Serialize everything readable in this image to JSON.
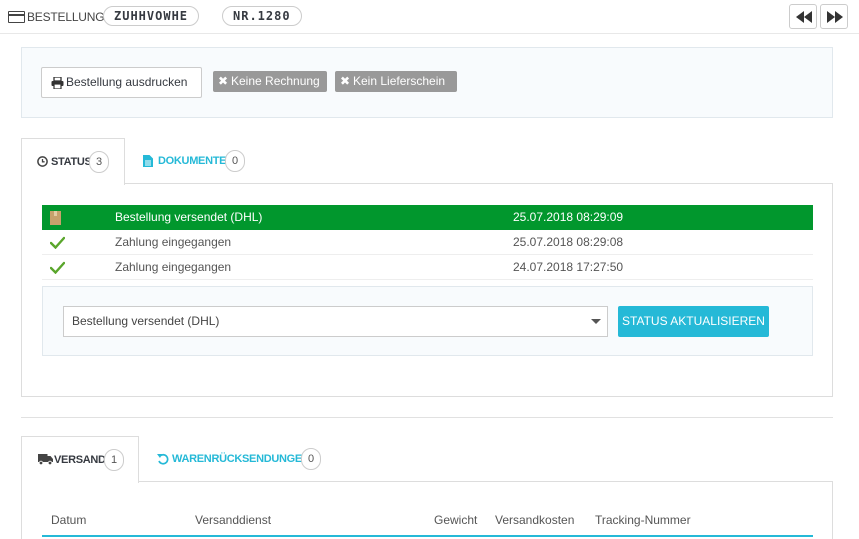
{
  "header": {
    "title": "BESTELLUNG",
    "reference": "ZUHHVOWHE",
    "number": "NR.1280",
    "icon": "credit-card-icon",
    "prev_icon": "backward-icon",
    "next_icon": "forward-icon"
  },
  "actions": {
    "print_label": "Bestellung ausdrucken",
    "no_invoice_label": "Keine Rechnung",
    "no_delivery_label": "Kein Lieferschein"
  },
  "tabs_top": [
    {
      "label": "STATUS",
      "count": "3",
      "icon": "clock-icon",
      "active": true
    },
    {
      "label": "DOKUMENTE",
      "count": "0",
      "icon": "file-icon",
      "active": false
    }
  ],
  "history": [
    {
      "state": "Bestellung versendet (DHL)",
      "date": "25.07.2018 08:29:09",
      "icon": "package-icon",
      "active": true
    },
    {
      "state": "Zahlung eingegangen",
      "date": "25.07.2018 08:29:08",
      "icon": "check-icon",
      "active": false
    },
    {
      "state": "Zahlung eingegangen",
      "date": "24.07.2018 17:27:50",
      "icon": "check-icon",
      "active": false
    }
  ],
  "status_form": {
    "selected": "Bestellung versendet (DHL)",
    "button_label": "STATUS AKTUALISIEREN"
  },
  "tabs_bottom": [
    {
      "label": "VERSAND",
      "count": "1",
      "icon": "truck-icon",
      "active": true
    },
    {
      "label": "WARENRÜCKSENDUNGEN",
      "count": "0",
      "icon": "undo-icon",
      "active": false
    }
  ],
  "shipping_table": {
    "columns": [
      "Datum",
      "Versanddienst",
      "Gewicht",
      "Versandkosten",
      "Tracking-Nummer"
    ]
  },
  "colors": {
    "accent": "#25b9d7",
    "active_state": "#01972d",
    "disabled_button": "#999999"
  }
}
